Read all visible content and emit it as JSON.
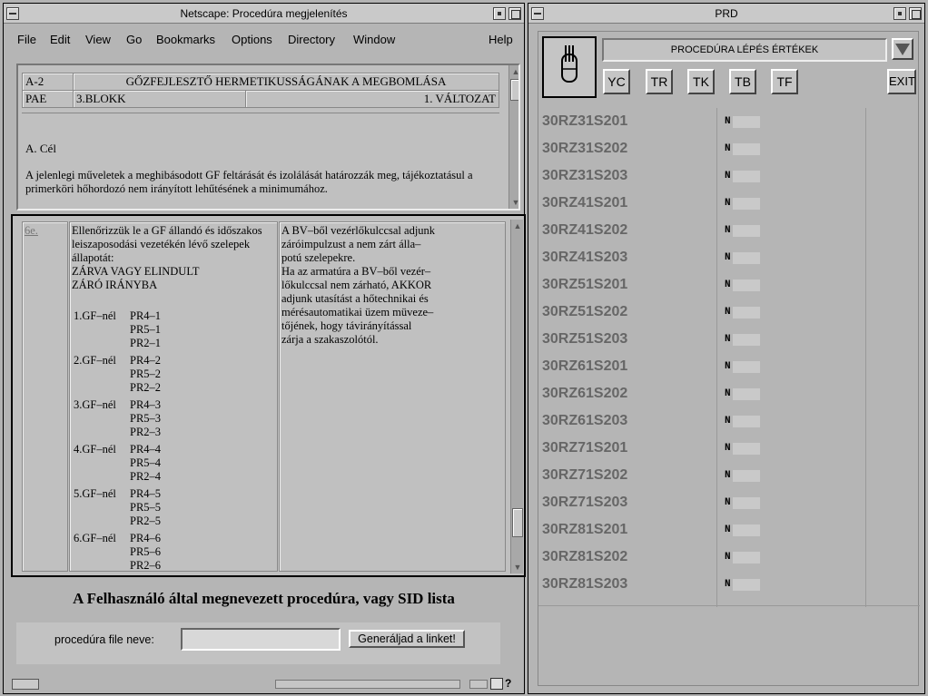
{
  "netscape": {
    "title": "Netscape: Procedúra megjelenítés",
    "menu": [
      "File",
      "Edit",
      "View",
      "Go",
      "Bookmarks",
      "Options",
      "Directory",
      "Window",
      "Help"
    ],
    "header_table": {
      "row1": {
        "code": "A-2",
        "title": "GŐZFEJLESZTŐ HERMETIKUSSÁGÁNAK A MEGBOMLÁSA"
      },
      "row2": {
        "code": "PAE",
        "unit": "3.BLOKK",
        "version": "1. VÁLTOZAT"
      }
    },
    "goal": {
      "title": "A. Cél",
      "text": "A jelenlegi műveletek a meghibásodott GF feltárását és izolálását határozzák meg, tájékoztatásul a primerköri hőhordozó nem irányított lehűtésének a minimumához."
    },
    "step": {
      "link": "6e.",
      "check_text": "Ellenőrizzük le a GF állandó és időszakos leiszaposodási vezetékén lévő szelepek állapotát:",
      "state_text": "ZÁRVA VAGY ELINDULT ZÁRÓ IRÁNYBA",
      "gf_list": [
        {
          "label": "1.GF–nél",
          "items": [
            "PR4–1",
            "PR5–1",
            "PR2–1"
          ]
        },
        {
          "label": "2.GF–nél",
          "items": [
            "PR4–2",
            "PR5–2",
            "PR2–2"
          ]
        },
        {
          "label": "3.GF–nél",
          "items": [
            "PR4–3",
            "PR5–3",
            "PR2–3"
          ]
        },
        {
          "label": "4.GF–nél",
          "items": [
            "PR4–4",
            "PR5–4",
            "PR2–4"
          ]
        },
        {
          "label": "5.GF–nél",
          "items": [
            "PR4–5",
            "PR5–5",
            "PR2–5"
          ]
        },
        {
          "label": "6.GF–nél",
          "items": [
            "PR4–6",
            "PR5–6",
            "PR2–6"
          ]
        }
      ],
      "action_lines": [
        "A BV–ből vezérlőkulccsal adjunk",
        "záróimpulzust a nem zárt álla–",
        "potú szelepekre.",
        "Ha az armatúra a BV–ből vezér–",
        "lőkulccsal nem zárható, AKKOR",
        "adjunk utasítást a hőtechnikai és",
        "mérésautomatikai üzem müveze–",
        "tőjének, hogy távirányítással",
        "zárja a szakaszolótól."
      ]
    },
    "form": {
      "heading": "A Felhasználó által megnevezett procedúra, vagy SID lista",
      "label": "procedúra file neve:",
      "input_value": "",
      "button": "Generáljad a linket!"
    }
  },
  "prd": {
    "title": "PRD",
    "header_label": "PROCEDÚRA LÉPÉS ÉRTÉKEK",
    "buttons": [
      "YC",
      "TR",
      "TK",
      "TB",
      "TF"
    ],
    "exit": "EXIT",
    "rows": [
      {
        "name": "30RZ31S201",
        "value": "N"
      },
      {
        "name": "30RZ31S202",
        "value": "N"
      },
      {
        "name": "30RZ31S203",
        "value": "N"
      },
      {
        "name": "30RZ41S201",
        "value": "N"
      },
      {
        "name": "30RZ41S202",
        "value": "N"
      },
      {
        "name": "30RZ41S203",
        "value": "N"
      },
      {
        "name": "30RZ51S201",
        "value": "N"
      },
      {
        "name": "30RZ51S202",
        "value": "N"
      },
      {
        "name": "30RZ51S203",
        "value": "N"
      },
      {
        "name": "30RZ61S201",
        "value": "N"
      },
      {
        "name": "30RZ61S202",
        "value": "N"
      },
      {
        "name": "30RZ61S203",
        "value": "N"
      },
      {
        "name": "30RZ71S201",
        "value": "N"
      },
      {
        "name": "30RZ71S202",
        "value": "N"
      },
      {
        "name": "30RZ71S203",
        "value": "N"
      },
      {
        "name": "30RZ81S201",
        "value": "N"
      },
      {
        "name": "30RZ81S202",
        "value": "N"
      },
      {
        "name": "30RZ81S203",
        "value": "N"
      }
    ]
  }
}
